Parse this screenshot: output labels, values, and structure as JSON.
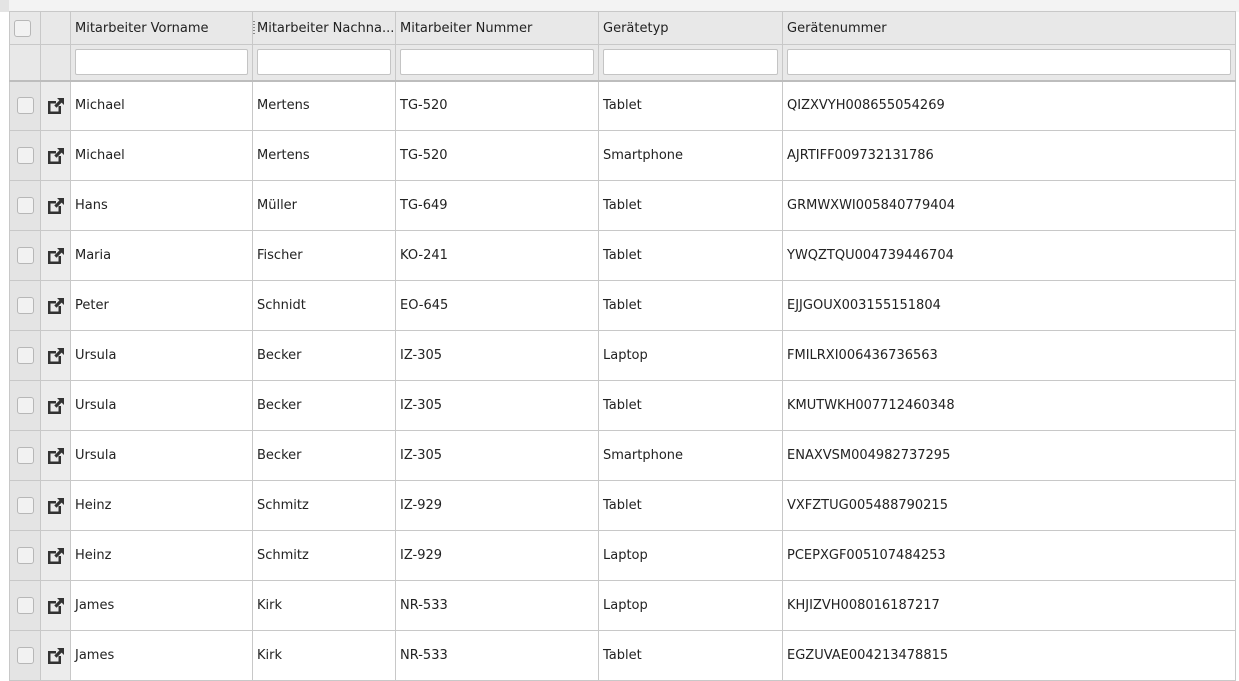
{
  "grid": {
    "columns": [
      "Mitarbeiter Vorname",
      "Mitarbeiter Nachna...",
      "Mitarbeiter Nummer",
      "Gerätetyp",
      "Gerätenummer"
    ],
    "rows": [
      [
        "Michael",
        "Mertens",
        "TG-520",
        "Tablet",
        "QIZXVYH008655054269"
      ],
      [
        "Michael",
        "Mertens",
        "TG-520",
        "Smartphone",
        "AJRTIFF009732131786"
      ],
      [
        "Hans",
        "Müller",
        "TG-649",
        "Tablet",
        "GRMWXWI005840779404"
      ],
      [
        "Maria",
        "Fischer",
        "KO-241",
        "Tablet",
        "YWQZTQU004739446704"
      ],
      [
        "Peter",
        "Schnidt",
        "EO-645",
        "Tablet",
        "EJJGOUX003155151804"
      ],
      [
        "Ursula",
        "Becker",
        "IZ-305",
        "Laptop",
        "FMILRXI006436736563"
      ],
      [
        "Ursula",
        "Becker",
        "IZ-305",
        "Tablet",
        "KMUTWKH007712460348"
      ],
      [
        "Ursula",
        "Becker",
        "IZ-305",
        "Smartphone",
        "ENAXVSM004982737295"
      ],
      [
        "Heinz",
        "Schmitz",
        "IZ-929",
        "Tablet",
        "VXFZTUG005488790215"
      ],
      [
        "Heinz",
        "Schmitz",
        "IZ-929",
        "Laptop",
        "PCEPXGF005107484253"
      ],
      [
        "James",
        "Kirk",
        "NR-533",
        "Laptop",
        "KHJIZVH008016187217"
      ],
      [
        "James",
        "Kirk",
        "NR-533",
        "Tablet",
        "EGZUVAE004213478815"
      ]
    ],
    "icons": {
      "row_checkbox": "checkbox-icon",
      "row_open": "open-external-icon",
      "column_resize": "column-resize-grip-icon"
    }
  }
}
